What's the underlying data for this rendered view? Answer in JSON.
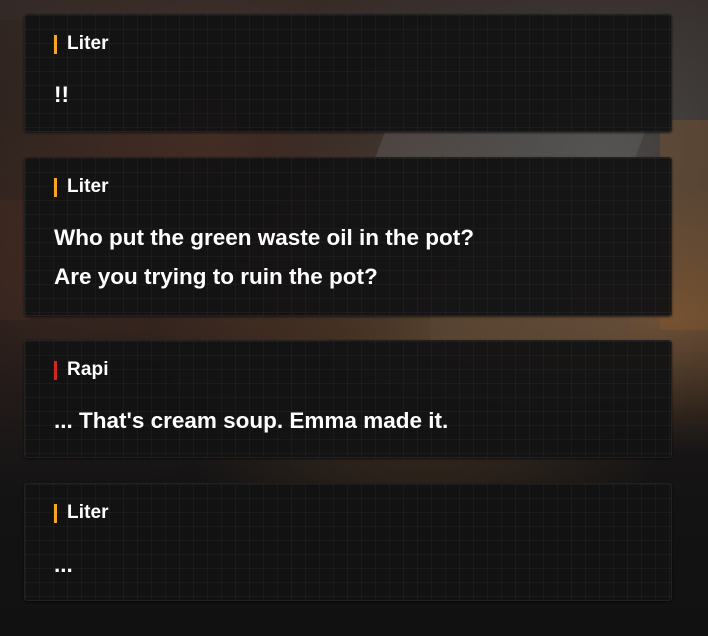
{
  "dialogues": [
    {
      "speaker": "Liter",
      "speaker_color": "#f5a623",
      "lines": [
        "!!"
      ]
    },
    {
      "speaker": "Liter",
      "speaker_color": "#f5a623",
      "lines": [
        "Who put the green waste oil in the pot?",
        "Are you trying to ruin the pot?"
      ]
    },
    {
      "speaker": "Rapi",
      "speaker_color": "#d0281e",
      "lines": [
        "... That's cream soup. Emma made it."
      ]
    },
    {
      "speaker": "Liter",
      "speaker_color": "#f5a623",
      "lines": [
        "..."
      ]
    }
  ]
}
